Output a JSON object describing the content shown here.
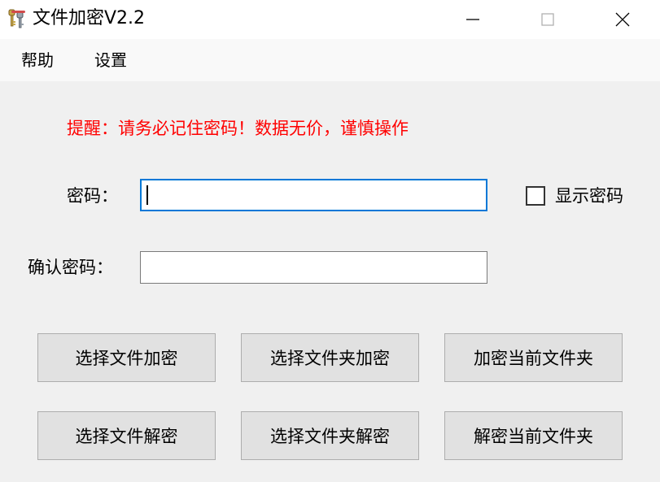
{
  "window": {
    "title": "文件加密V2.2",
    "icon": "keys-icon"
  },
  "menu": {
    "help": "帮助",
    "settings": "设置"
  },
  "warning": {
    "text": "提醒：请务必记住密码！数据无价，谨慎操作",
    "color": "#ff0000"
  },
  "form": {
    "password_label": "密码：",
    "password_value": "",
    "confirm_label": "确认密码：",
    "confirm_value": "",
    "show_password_label": "显示密码",
    "show_password_checked": false
  },
  "buttons": {
    "encrypt_file": "选择文件加密",
    "encrypt_folder": "选择文件夹加密",
    "encrypt_current_folder": "加密当前文件夹",
    "decrypt_file": "选择文件解密",
    "decrypt_folder": "选择文件夹解密",
    "decrypt_current_folder": "解密当前文件夹"
  },
  "colors": {
    "focus_border": "#0078d7",
    "button_face": "#e1e1e1"
  }
}
